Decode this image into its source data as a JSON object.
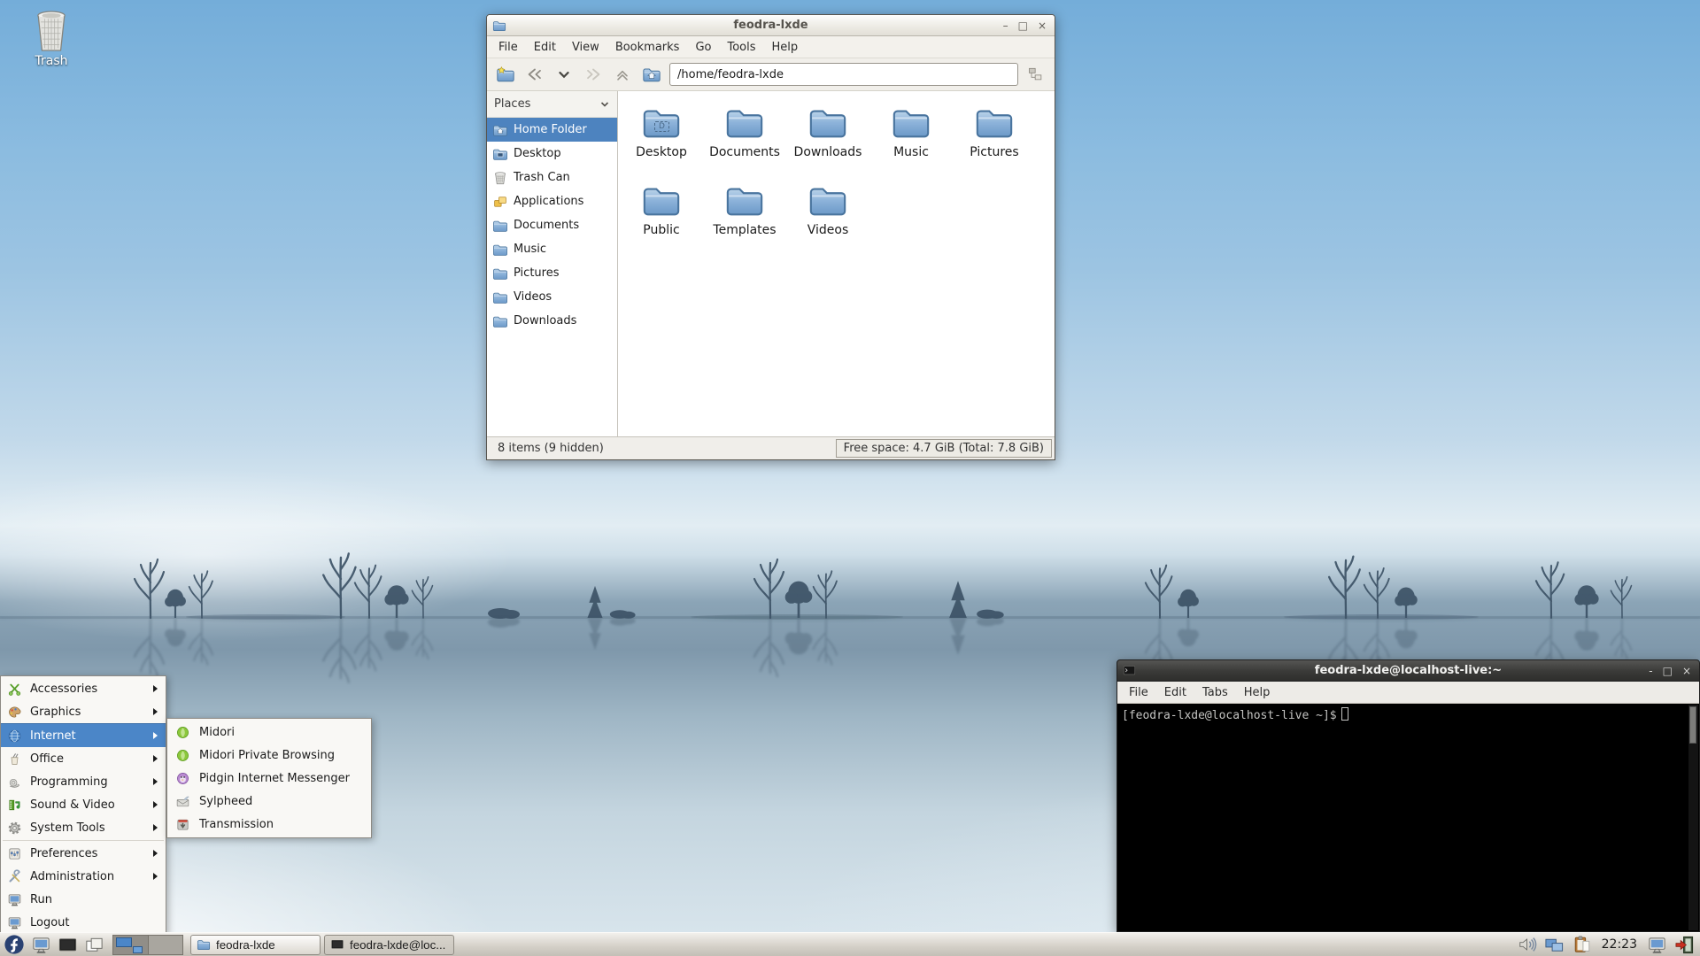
{
  "desktop": {
    "trash_label": "Trash"
  },
  "colors": {
    "selection_blue": "#4b86c8",
    "sidebar_selection": "#4d83bf",
    "folder_blue": "#7fa9d4",
    "terminal_title_bg": "#3a3a38",
    "taskbar_bg": "#d6d2ca",
    "wallpaper_sky": "#74add9",
    "tree_silhouette": "#3d5266"
  },
  "file_manager": {
    "title": "feodra-lxde",
    "window_buttons": {
      "minimize": "–",
      "maximize": "□",
      "close": "×"
    },
    "menu": [
      "File",
      "Edit",
      "View",
      "Bookmarks",
      "Go",
      "Tools",
      "Help"
    ],
    "path": "/home/feodra-lxde",
    "places_header": "Places",
    "places": [
      {
        "label": "Home Folder",
        "icon": "home-folder-icon",
        "selected": true
      },
      {
        "label": "Desktop",
        "icon": "desktop-folder-icon"
      },
      {
        "label": "Trash Can",
        "icon": "trash-can-icon"
      },
      {
        "label": "Applications",
        "icon": "applications-icon"
      },
      {
        "label": "Documents",
        "icon": "folder-icon"
      },
      {
        "label": "Music",
        "icon": "folder-icon"
      },
      {
        "label": "Pictures",
        "icon": "folder-icon"
      },
      {
        "label": "Videos",
        "icon": "folder-icon"
      },
      {
        "label": "Downloads",
        "icon": "folder-icon"
      }
    ],
    "files": [
      {
        "label": "Desktop",
        "icon": "folder-icon",
        "emblem": "D"
      },
      {
        "label": "Documents",
        "icon": "folder-icon"
      },
      {
        "label": "Downloads",
        "icon": "folder-icon"
      },
      {
        "label": "Music",
        "icon": "folder-icon"
      },
      {
        "label": "Pictures",
        "icon": "folder-icon"
      },
      {
        "label": "Public",
        "icon": "folder-icon"
      },
      {
        "label": "Templates",
        "icon": "folder-icon"
      },
      {
        "label": "Videos",
        "icon": "folder-icon"
      }
    ],
    "status_left": "8 items (9 hidden)",
    "status_right": "Free space: 4.7 GiB (Total: 7.8 GiB)"
  },
  "terminal": {
    "title": "feodra-lxde@localhost-live:~",
    "window_buttons": {
      "minimize": "-",
      "maximize": "□",
      "close": "×"
    },
    "menu": [
      "File",
      "Edit",
      "Tabs",
      "Help"
    ],
    "prompt": "[feodra-lxde@localhost-live ~]$"
  },
  "app_menu": {
    "items": [
      {
        "label": "Accessories",
        "icon": "scissors-icon",
        "submenu": true
      },
      {
        "label": "Graphics",
        "icon": "palette-icon",
        "submenu": true
      },
      {
        "label": "Internet",
        "icon": "globe-icon",
        "submenu": true,
        "selected": true
      },
      {
        "label": "Office",
        "icon": "office-icon",
        "submenu": true
      },
      {
        "label": "Programming",
        "icon": "programming-icon",
        "submenu": true
      },
      {
        "label": "Sound & Video",
        "icon": "filmstrip-icon",
        "submenu": true
      },
      {
        "label": "System Tools",
        "icon": "gear-icon",
        "submenu": true
      },
      {
        "label": "Preferences",
        "icon": "preferences-icon",
        "submenu": true
      },
      {
        "label": "Administration",
        "icon": "admin-tools-icon",
        "submenu": true
      },
      {
        "label": "Run",
        "icon": "monitor-icon",
        "submenu": false
      },
      {
        "label": "Logout",
        "icon": "monitor-icon",
        "submenu": false
      }
    ],
    "submenu": [
      {
        "label": "Midori",
        "icon": "midori-leaf-icon"
      },
      {
        "label": "Midori Private Browsing",
        "icon": "midori-leaf-icon"
      },
      {
        "label": "Pidgin Internet Messenger",
        "icon": "pidgin-icon"
      },
      {
        "label": "Sylpheed",
        "icon": "sylpheed-icon"
      },
      {
        "label": "Transmission",
        "icon": "transmission-icon"
      }
    ]
  },
  "taskbar": {
    "task_buttons": [
      {
        "label": "feodra-lxde",
        "icon": "folder-icon"
      },
      {
        "label": "feodra-lxde@loc...",
        "icon": "terminal-icon"
      }
    ],
    "clock": "22:23"
  }
}
